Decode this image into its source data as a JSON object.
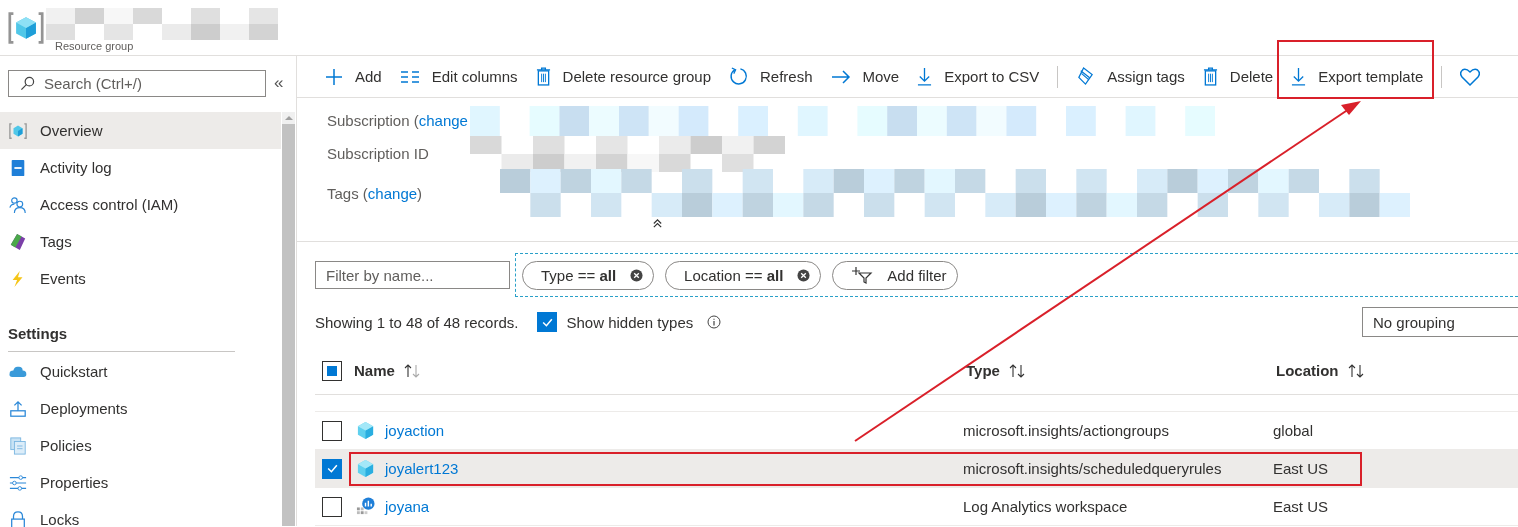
{
  "header": {
    "subtitle": "Resource group"
  },
  "sidebar": {
    "search_placeholder": "Search (Ctrl+/)",
    "collapse": "«",
    "sections": [
      {
        "items": [
          {
            "label": "Overview",
            "selected": true
          },
          {
            "label": "Activity log",
            "selected": false
          },
          {
            "label": "Access control (IAM)",
            "selected": false
          },
          {
            "label": "Tags",
            "selected": false
          },
          {
            "label": "Events",
            "selected": false
          }
        ]
      },
      {
        "title": "Settings",
        "items": [
          {
            "label": "Quickstart",
            "selected": false
          },
          {
            "label": "Deployments",
            "selected": false
          },
          {
            "label": "Policies",
            "selected": false
          },
          {
            "label": "Properties",
            "selected": false
          },
          {
            "label": "Locks",
            "selected": false
          }
        ]
      }
    ]
  },
  "toolbar": [
    {
      "kind": "button",
      "label": "Add",
      "highlighted": false
    },
    {
      "kind": "button",
      "label": "Edit columns",
      "highlighted": false
    },
    {
      "kind": "button",
      "label": "Delete resource group",
      "highlighted": false
    },
    {
      "kind": "button",
      "label": "Refresh",
      "highlighted": false
    },
    {
      "kind": "button",
      "label": "Move",
      "highlighted": false
    },
    {
      "kind": "button",
      "label": "Export to CSV",
      "highlighted": false
    },
    {
      "kind": "separator"
    },
    {
      "kind": "button",
      "label": "Assign tags",
      "highlighted": false
    },
    {
      "kind": "button",
      "label": "Delete",
      "highlighted": false
    },
    {
      "kind": "button",
      "label": "Export template",
      "highlighted": true
    },
    {
      "kind": "separator"
    },
    {
      "kind": "icon"
    }
  ],
  "essentials": [
    {
      "label": "Subscription (",
      "link": "change"
    },
    {
      "label": "Subscription ID"
    },
    {
      "label": "Tags (",
      "link": "change",
      "suffix": ")"
    }
  ],
  "filters": {
    "name_placeholder": "Filter by name...",
    "pills": [
      "Type == **all**",
      "Location == **all**"
    ],
    "add_filter": "Add filter"
  },
  "records": {
    "summary": "Showing 1 to 48 of 48 records.",
    "show_hidden": {
      "label": "Show hidden types",
      "checked": true
    },
    "grouping": "No grouping"
  },
  "table": {
    "select_all": {
      "partial": true
    },
    "columns": [
      {
        "label": "Name"
      },
      {
        "label": "Type"
      },
      {
        "label": "Location"
      }
    ],
    "rows": [
      {
        "kind": "resource",
        "name": "joyaction",
        "type": "microsoft.insights/actiongroups",
        "location": "global",
        "selected": false,
        "highlighted": false
      },
      {
        "kind": "resource",
        "name": "joyalert123",
        "type": "microsoft.insights/scheduledqueryrules",
        "location": "East US",
        "selected": true,
        "highlighted": true
      },
      {
        "kind": "workspace",
        "name": "joyana",
        "type": "Log Analytics workspace",
        "location": "East US",
        "selected": false,
        "highlighted": false
      }
    ]
  }
}
